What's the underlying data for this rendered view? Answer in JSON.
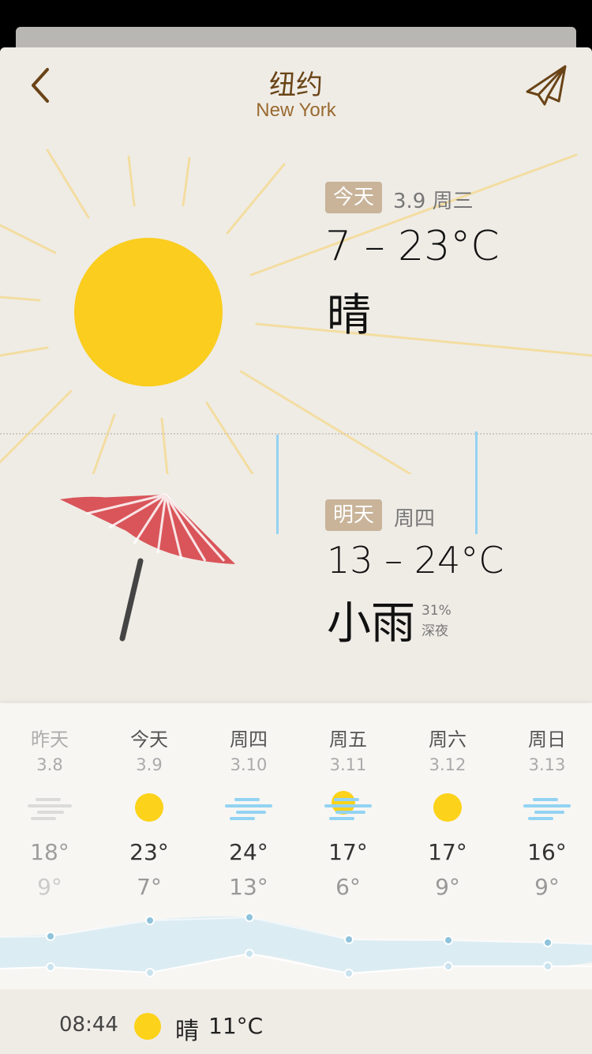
{
  "header": {
    "city_cn": "纽约",
    "city_en": "New York"
  },
  "today": {
    "tag": "今天",
    "date_weekday": "3.9 周三",
    "temp_range": "7 – 23°C",
    "condition": "晴"
  },
  "tomorrow": {
    "tag": "明天",
    "weekday": "周四",
    "temp_range": "13 – 24°C",
    "condition": "小雨",
    "rain_chance": "31%",
    "rain_time": "深夜"
  },
  "forecast": [
    {
      "day": "昨天",
      "date": "3.8",
      "icon": "cloud-mist-icon",
      "high": "18°",
      "low": "9°"
    },
    {
      "day": "今天",
      "date": "3.9",
      "icon": "sun-icon",
      "high": "23°",
      "low": "7°"
    },
    {
      "day": "周四",
      "date": "3.10",
      "icon": "rain-wind-icon",
      "high": "24°",
      "low": "13°"
    },
    {
      "day": "周五",
      "date": "3.11",
      "icon": "sun-rain-icon",
      "high": "17°",
      "low": "6°"
    },
    {
      "day": "周六",
      "date": "3.12",
      "icon": "sun-icon",
      "high": "17°",
      "low": "9°"
    },
    {
      "day": "周日",
      "date": "3.13",
      "icon": "rain-wind-icon",
      "high": "16°",
      "low": "9°"
    }
  ],
  "bottom": {
    "time": "08:44",
    "condition": "晴",
    "temp": "11°C"
  },
  "colors": {
    "sun": "#fcd21a",
    "rain": "#93d3f2",
    "umbrella": "#d9555a",
    "accent_brown": "#6a4417",
    "tag_bg": "#c9b49a"
  }
}
